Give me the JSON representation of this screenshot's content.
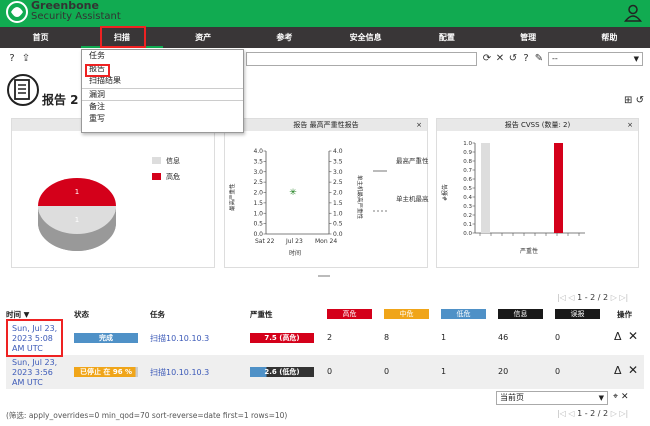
{
  "header": {
    "brand_line1": "Greenbone",
    "brand_line2": "Security Assistant"
  },
  "nav": {
    "items": [
      "首页",
      "扫描",
      "资产",
      "参考",
      "安全信息",
      "配置",
      "管理",
      "帮助"
    ]
  },
  "scan_menu": {
    "items": [
      "任务",
      "报告",
      "扫描结果",
      "漏洞",
      "备注",
      "重写"
    ]
  },
  "toolbar": {
    "filter_select_value": "--"
  },
  "page": {
    "title": "报告 2"
  },
  "panels": {
    "p1": {
      "title": "报告",
      "close": "×",
      "legend": [
        "信息",
        "高危"
      ],
      "slice_top_label": "1",
      "slice_bottom_label": "1"
    },
    "p2": {
      "title": "报告 最高严重性报告",
      "close": "×",
      "y_ticks": [
        "4.0",
        "3.5",
        "3.0",
        "2.5",
        "2.0",
        "1.5",
        "1.0",
        "0.5",
        "0.0"
      ],
      "x_ticks": [
        "Sat 22",
        "Jul 23",
        "Mon 24"
      ],
      "xlabel": "时间",
      "ylabel_left": "最高严重性",
      "ylabel_right": "单主机最高严重性",
      "legend1": "最高严重性",
      "legend2": "单主机最高严重性"
    },
    "p3": {
      "title": "报告 CVSS (数量: 2)",
      "close": "×",
      "xlabel": "严重性",
      "ylabel": "#报告"
    }
  },
  "chart_data": [
    {
      "type": "pie",
      "title": "报告",
      "categories": [
        "信息",
        "高危"
      ],
      "values": [
        1,
        1
      ],
      "colors": [
        "#dddddd",
        "#d4001a"
      ]
    },
    {
      "type": "bar",
      "title": "报告 CVSS (数量: 2)",
      "xlabel": "严重性",
      "ylabel": "#报告",
      "categories": [
        "0",
        "7.5"
      ],
      "values": [
        1,
        1
      ],
      "y_ticks": [
        "1.0",
        "0.9",
        "0.8",
        "0.7",
        "0.6",
        "0.5",
        "0.4",
        "0.3",
        "0.2",
        "0.1",
        "0.0"
      ],
      "ylim": [
        0,
        1
      ],
      "colors": [
        "#dddddd",
        "#d4001a"
      ]
    }
  ],
  "pager": {
    "text": "1 - 2 / 2"
  },
  "table": {
    "headers": {
      "time": "时间 ▼",
      "status": "状态",
      "task": "任务",
      "severity": "严重性",
      "high": "高危",
      "medium": "中危",
      "low": "低危",
      "log": "信息",
      "false_pos": "误报",
      "actions": "操作"
    },
    "rows": [
      {
        "date": "Sun, Jul 23, 2023 5:08 AM UTC",
        "status": "完成",
        "task": "扫描10.10.10.3",
        "severity": "7.5 (高危)",
        "high": "2",
        "medium": "8",
        "low": "1",
        "log": "46",
        "false_pos": "0"
      },
      {
        "date": "Sun, Jul 23, 2023 3:56 AM UTC",
        "status": "已停止 在 96 %",
        "task": "扫描10.10.10.3",
        "severity": "2.6 (低危)",
        "high": "0",
        "medium": "0",
        "low": "1",
        "log": "20",
        "false_pos": "0"
      }
    ]
  },
  "bottom": {
    "select_value": "当前页",
    "filter_text": "(筛选: apply_overrides=0 min_qod=70 sort-reverse=date first=1 rows=10)"
  },
  "colors": {
    "brand_green": "#11ab51",
    "nav_dark": "#393637",
    "high": "#d4001a",
    "medium": "#f0a519",
    "low": "#4f91c7",
    "log": "#191919",
    "done_blue": "#4f91c7",
    "stopped_orange": "#f0a519"
  }
}
